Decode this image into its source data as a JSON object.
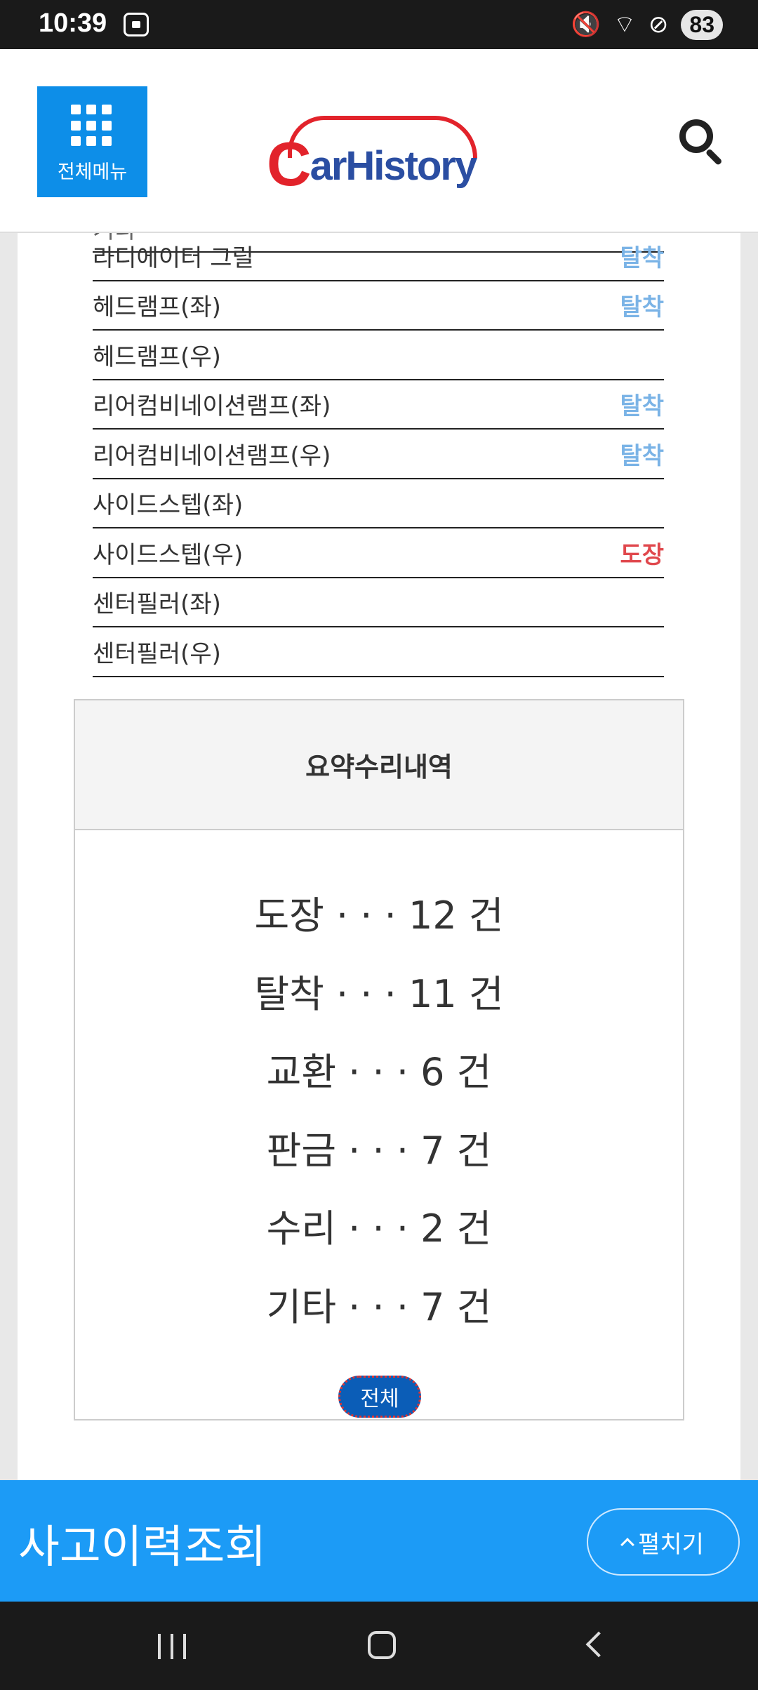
{
  "status_bar": {
    "time": "10:39",
    "battery": "83"
  },
  "header": {
    "menu_label": "전체메뉴",
    "logo_c": "C",
    "logo_rest": "arHistory"
  },
  "partial_row_label": "기타",
  "parts": [
    {
      "name": "라디에이터 그릴",
      "status": "탈착",
      "status_color": "#7ab3e6"
    },
    {
      "name": "헤드램프(좌)",
      "status": "탈착",
      "status_color": "#7ab3e6"
    },
    {
      "name": "헤드램프(우)",
      "status": "",
      "status_color": "#7ab3e6"
    },
    {
      "name": "리어컴비네이션램프(좌)",
      "status": "탈착",
      "status_color": "#7ab3e6"
    },
    {
      "name": "리어컴비네이션램프(우)",
      "status": "탈착",
      "status_color": "#7ab3e6"
    },
    {
      "name": "사이드스텝(좌)",
      "status": "",
      "status_color": "#7ab3e6"
    },
    {
      "name": "사이드스텝(우)",
      "status": "도장",
      "status_color": "#e0484d"
    },
    {
      "name": "센터필러(좌)",
      "status": "",
      "status_color": "#7ab3e6"
    },
    {
      "name": "센터필러(우)",
      "status": "",
      "status_color": "#7ab3e6"
    }
  ],
  "summary": {
    "title": "요약수리내역",
    "items": [
      "도장 · · · 12 건",
      "탈착 · · · 11 건",
      "교환 · · · 6 건",
      "판금 · · · 7 건",
      "수리 · · · 2 건",
      "기타 · · · 7 건"
    ],
    "all_button": "전체"
  },
  "bottom_bar": {
    "title": "사고이력조회",
    "expand_label": "펼치기"
  }
}
